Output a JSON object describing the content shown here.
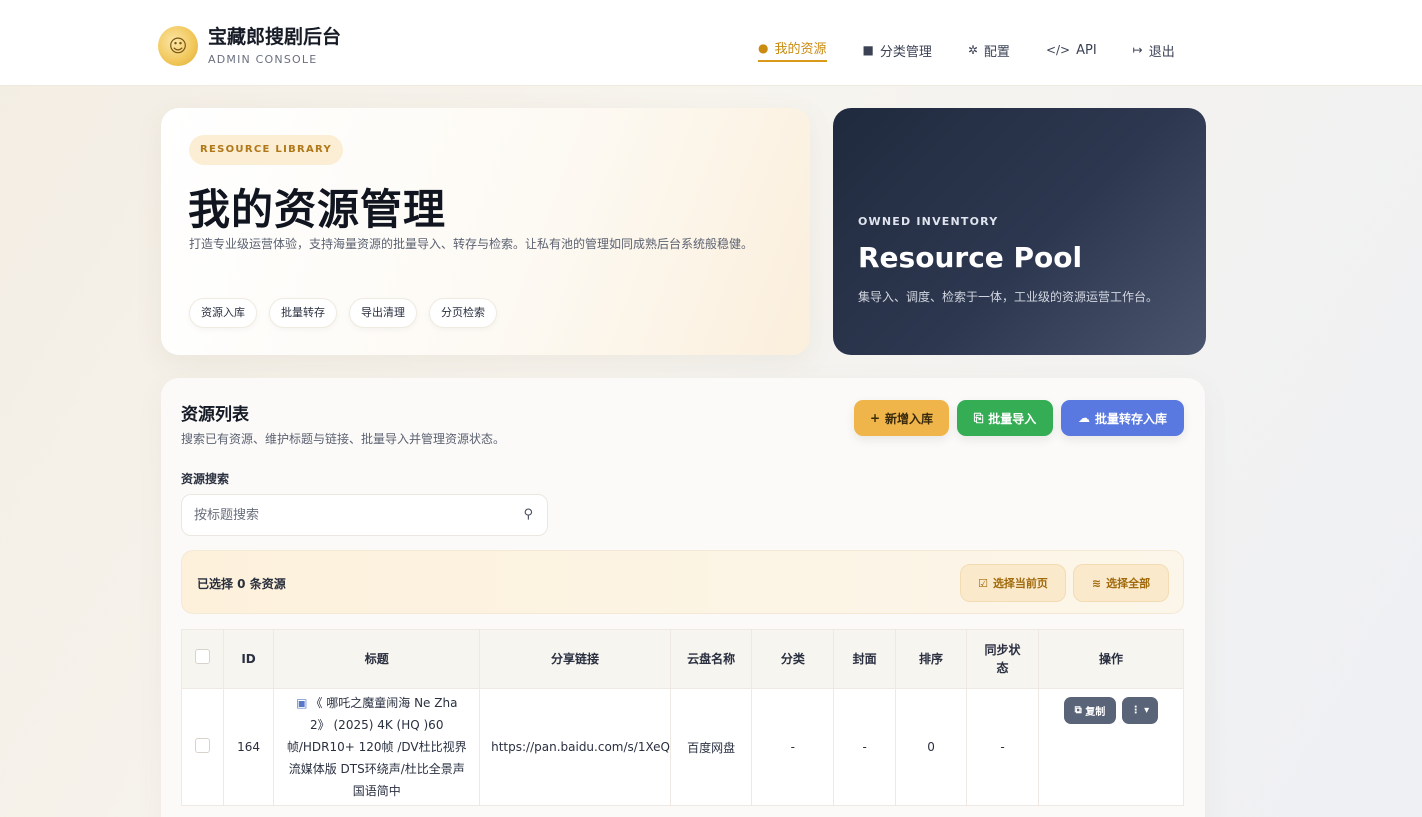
{
  "header": {
    "brand_title": "宝藏郎搜剧后台",
    "brand_sub": "ADMIN CONSOLE",
    "logo_icon": "golden-mascot-logo",
    "nav": [
      {
        "label": "我的资源",
        "icon": "fire-icon",
        "active": true
      },
      {
        "label": "分类管理",
        "icon": "folder-icon"
      },
      {
        "label": "配置",
        "icon": "gear-icon"
      },
      {
        "label": "API",
        "icon": "code-icon"
      },
      {
        "label": "退出",
        "icon": "logout-icon"
      }
    ]
  },
  "hero": {
    "chip": "RESOURCE LIBRARY",
    "title": "我的资源管理",
    "desc": "打造专业级运营体验，支持海量资源的批量导入、转存与检索。让私有池的管理如同成熟后台系统般稳健。",
    "tags": [
      "资源入库",
      "批量转存",
      "导出清理",
      "分页检索"
    ]
  },
  "pool": {
    "kicker": "OWNED INVENTORY",
    "title": "Resource Pool",
    "desc": "集导入、调度、检索于一体，工业级的资源运营工作台。"
  },
  "list": {
    "title": "资源列表",
    "subtitle": "搜索已有资源、维护标题与链接、批量导入并管理资源状态。",
    "buttons": {
      "add": "新增入库",
      "import": "批量导入",
      "transfer": "批量转存入库"
    },
    "search_label": "资源搜索",
    "search_placeholder": "按标题搜索",
    "selection_text": "已选择 0 条资源",
    "select_page": "选择当前页",
    "select_all": "选择全部",
    "columns": [
      "ID",
      "标题",
      "分享链接",
      "云盘名称",
      "分类",
      "封面",
      "排序",
      "同步状态",
      "操作"
    ],
    "rows": [
      {
        "id": "164",
        "title": "《 哪吒之魔童闹海 Ne Zha 2》 (2025) 4K (HQ )60帧/HDR10+ 120帧 /DV杜比视界 流媒体版 DTS环绕声/杜比全景声 国语简中",
        "link": "https://pan.baidu.com/s/1XeQ",
        "disk": "百度网盘",
        "category": "-",
        "cover": "-",
        "sort": "0",
        "sync": "-",
        "copy_label": "复制",
        "more_label": "⋮ ▾"
      }
    ]
  },
  "colors": {
    "accent": "#d99a1c",
    "add_btn": "#f0b54a",
    "import_btn": "#35ad55",
    "transfer_btn": "#5978e0",
    "pool_bg": "#2d3850"
  }
}
